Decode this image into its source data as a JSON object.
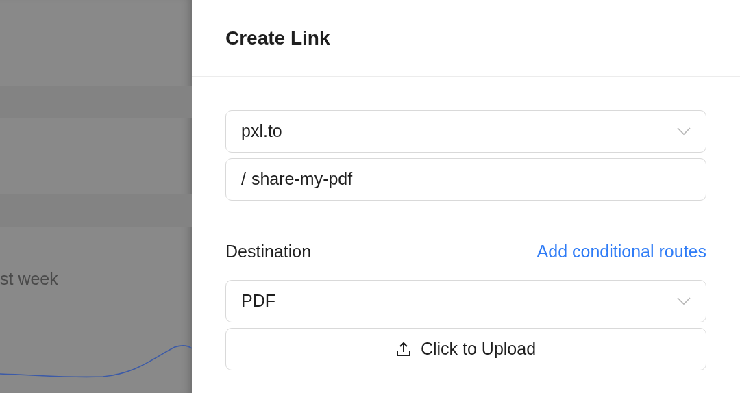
{
  "background": {
    "caption": "st week"
  },
  "drawer": {
    "title": "Create Link",
    "domain_select": {
      "value": "pxl.to"
    },
    "slug_input": {
      "prefix": "/",
      "value": "share-my-pdf"
    },
    "destination": {
      "label": "Destination",
      "link": "Add conditional routes",
      "type_select": {
        "value": "PDF"
      },
      "upload_button": "Click to Upload"
    }
  }
}
